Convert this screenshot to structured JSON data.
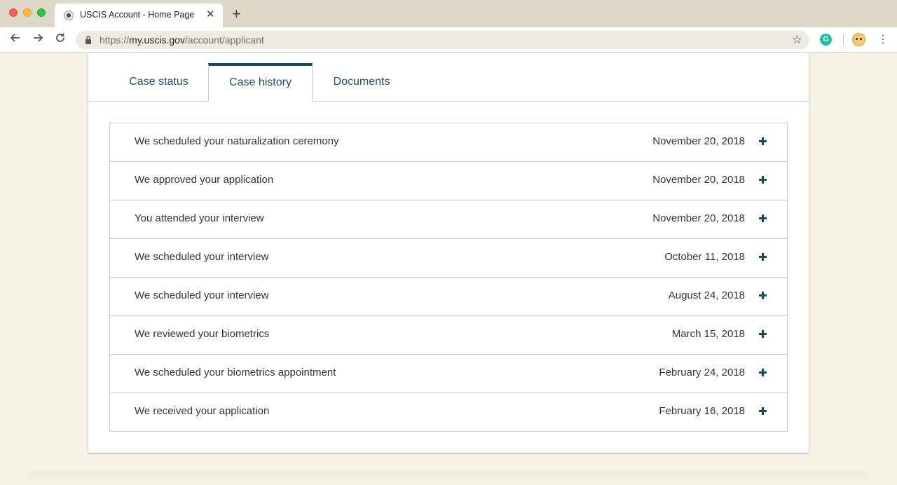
{
  "browser": {
    "tab_title": "USCIS Account - Home Page",
    "tab_close": "✕",
    "new_tab": "+",
    "url_scheme": "https://",
    "url_host": "my.uscis.gov",
    "url_path": "/account/applicant",
    "extension_label": "G",
    "menu": "⋮"
  },
  "page_tabs": [
    {
      "label": "Case status",
      "active": false
    },
    {
      "label": "Case history",
      "active": true
    },
    {
      "label": "Documents",
      "active": false
    }
  ],
  "history": [
    {
      "title": "We scheduled your naturalization ceremony",
      "date": "November 20, 2018"
    },
    {
      "title": "We approved your application",
      "date": "November 20, 2018"
    },
    {
      "title": "You attended your interview",
      "date": "November 20, 2018"
    },
    {
      "title": "We scheduled your interview",
      "date": "October 11, 2018"
    },
    {
      "title": "We scheduled your interview",
      "date": "August 24, 2018"
    },
    {
      "title": "We reviewed your biometrics",
      "date": "March 15, 2018"
    },
    {
      "title": "We scheduled your biometrics appointment",
      "date": "February 24, 2018"
    },
    {
      "title": "We received your application",
      "date": "February 16, 2018"
    }
  ],
  "colors": {
    "accent": "#0f4d6b",
    "page_background": "#f6f3e5"
  }
}
